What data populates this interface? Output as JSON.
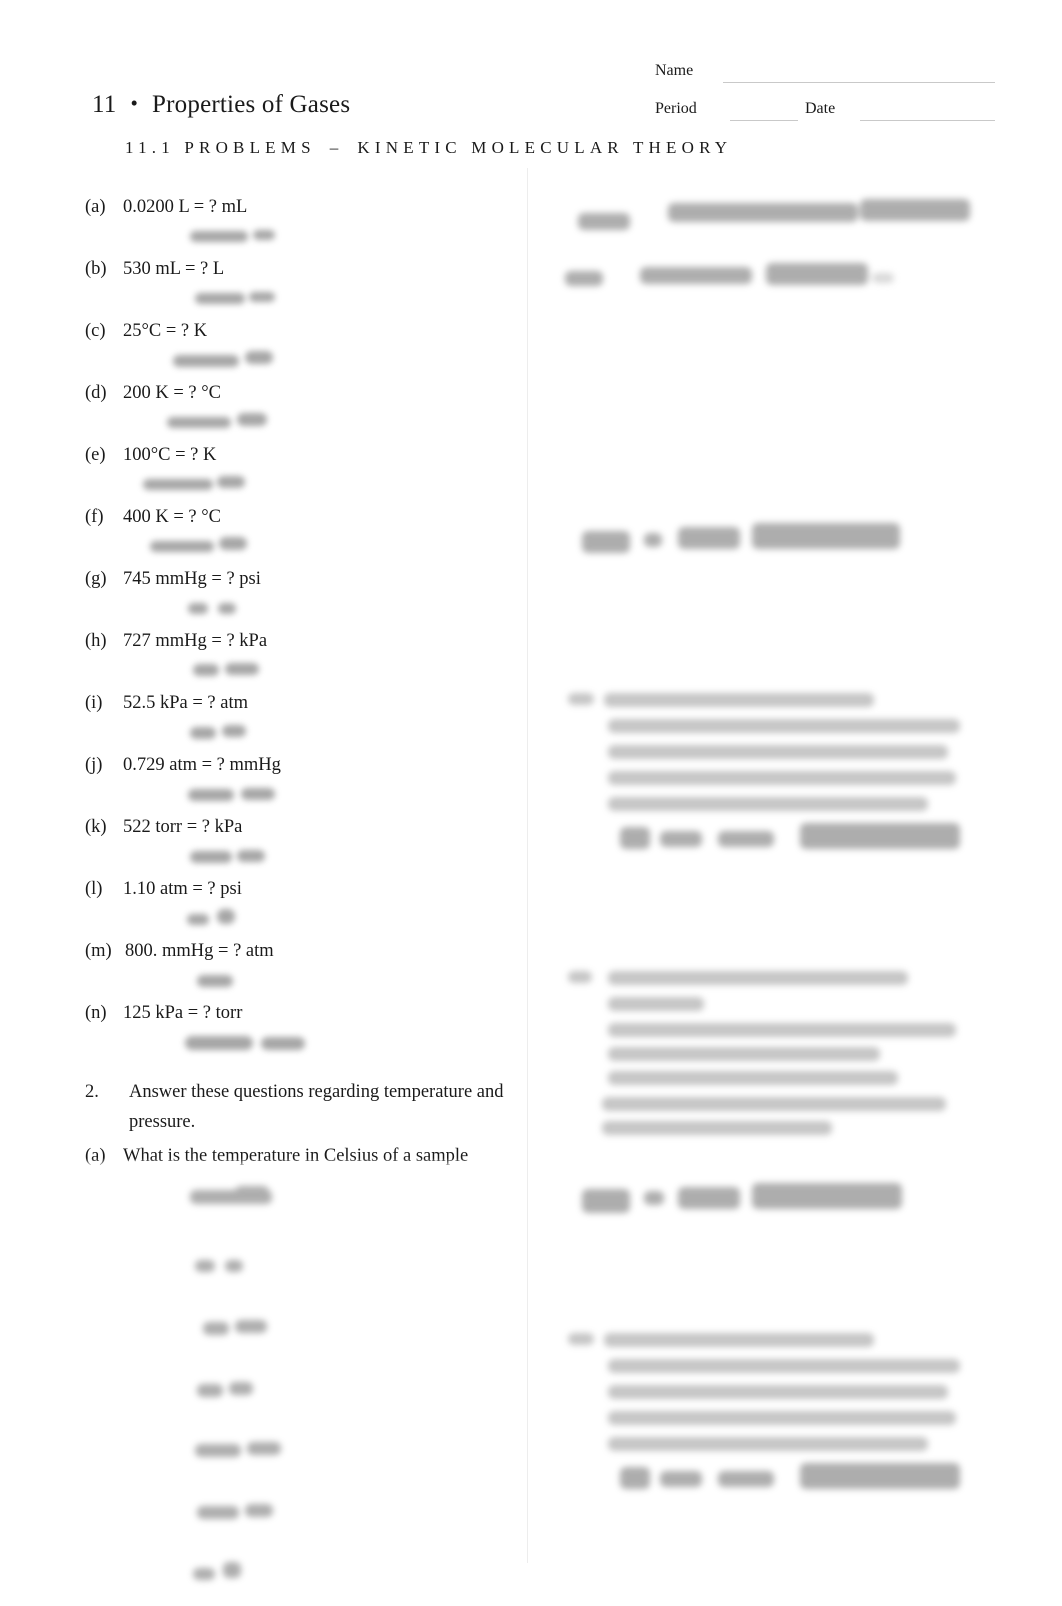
{
  "header": {
    "chapter_number": "11",
    "bullet": "•",
    "chapter_title": "Properties of Gases",
    "name_label": "Name",
    "period_label": "Period",
    "date_label": "Date",
    "name_value": "",
    "period_value": "",
    "date_value": ""
  },
  "section": {
    "title": "11.1 PROBLEMS",
    "dash": "–",
    "subtitle": "KINETIC MOLECULAR THEORY"
  },
  "problem_1": {
    "items": [
      {
        "label": "(a)",
        "text": "0.0200 L = ? mL"
      },
      {
        "label": "(b)",
        "text": "530 mL = ? L"
      },
      {
        "label": "(c)",
        "text": "25°C = ? K"
      },
      {
        "label": "(d)",
        "text": "200 K = ? °C"
      },
      {
        "label": "(e)",
        "text": "100°C = ? K"
      },
      {
        "label": "(f)",
        "text": "400 K = ? °C"
      },
      {
        "label": "(g)",
        "text": "745 mmHg = ? psi"
      },
      {
        "label": "(h)",
        "text": "727 mmHg = ? kPa"
      },
      {
        "label": "(i)",
        "text": "52.5 kPa = ? atm"
      },
      {
        "label": "(j)",
        "text": "0.729 atm = ? mmHg"
      },
      {
        "label": "(k)",
        "text": "522 torr = ? kPa"
      },
      {
        "label": "(l)",
        "text": "1.10 atm = ? psi"
      },
      {
        "label": "(m)",
        "text": "800. mmHg = ? atm"
      },
      {
        "label": "(n)",
        "text": "125 kPa = ? torr"
      }
    ]
  },
  "problem_2": {
    "number": "2.",
    "prompt": "Answer these questions regarding temperature and pressure.",
    "items": [
      {
        "label": "(a)",
        "text": "What is the temperature in Celsius of a sample"
      }
    ]
  },
  "colors": {
    "page_background": "#ffffff",
    "text": "#1a1a1a",
    "rule": "#c9c9c9",
    "divider": "#ededed",
    "handwriting": "#6f6f6f"
  }
}
